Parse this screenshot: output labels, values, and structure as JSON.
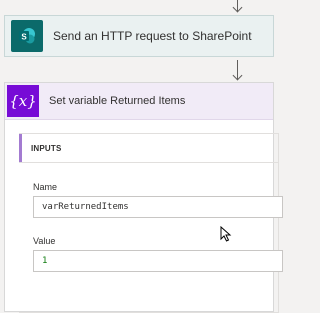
{
  "steps": {
    "http_request": {
      "title": "Send an HTTP request to SharePoint",
      "icon": "sharepoint-icon",
      "color": "#0b6a6a"
    },
    "set_variable": {
      "title": "Set variable Returned Items",
      "icon": "variable-icon",
      "icon_text": "{x}",
      "color": "#770bd6",
      "inputs": {
        "header": "INPUTS",
        "name_label": "Name",
        "name_value": "varReturnedItems",
        "value_label": "Value",
        "value_value": "1"
      }
    }
  }
}
